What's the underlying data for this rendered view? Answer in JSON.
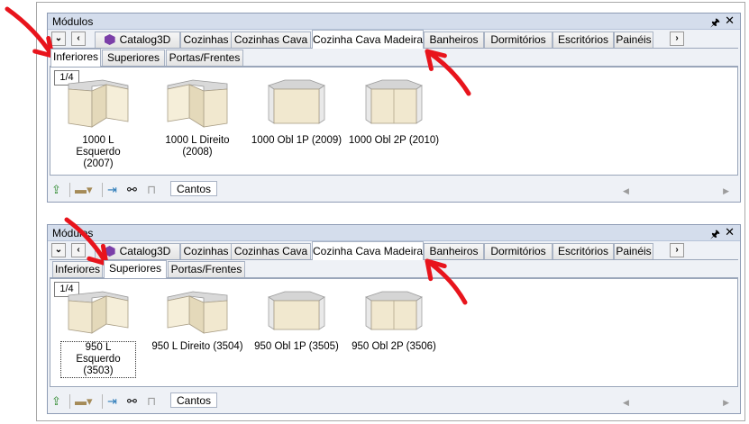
{
  "panels": [
    {
      "title": "Módulos",
      "pin_glyph": "🖈",
      "close_glyph": "✕",
      "nav_down": "⌄",
      "nav_left": "‹",
      "nav_right": "›",
      "tabs": [
        {
          "label": "Catalog3D",
          "icon": "cube-icon",
          "active": false
        },
        {
          "label": "Cozinhas",
          "active": false
        },
        {
          "label": "Cozinhas Cava",
          "active": false
        },
        {
          "label": "Cozinha Cava Madeira",
          "active": true
        },
        {
          "label": "Banheiros",
          "active": false
        },
        {
          "label": "Dormitórios",
          "active": false
        },
        {
          "label": "Escritórios",
          "active": false
        },
        {
          "label": "Painéis",
          "active": false
        }
      ],
      "subtabs": [
        {
          "label": "Inferiores",
          "active": true
        },
        {
          "label": "Superiores",
          "active": false
        },
        {
          "label": "Portas/Frentes",
          "active": false
        }
      ],
      "pager": "1/4",
      "items": [
        {
          "label": "1000 L Esquerdo (2007)",
          "shape": "l-left",
          "selected": false
        },
        {
          "label": "1000 L Direito (2008)",
          "shape": "l-right",
          "selected": false
        },
        {
          "label": "1000 Obl 1P (2009)",
          "shape": "obl",
          "selected": false
        },
        {
          "label": "1000 Obl 2P (2010)",
          "shape": "obl2",
          "selected": false
        }
      ],
      "bottom": {
        "tab_label": "Cantos"
      }
    },
    {
      "title": "Módulos",
      "pin_glyph": "🖈",
      "close_glyph": "✕",
      "nav_down": "⌄",
      "nav_left": "‹",
      "nav_right": "›",
      "tabs": [
        {
          "label": "Catalog3D",
          "icon": "cube-icon",
          "active": false
        },
        {
          "label": "Cozinhas",
          "active": false
        },
        {
          "label": "Cozinhas Cava",
          "active": false
        },
        {
          "label": "Cozinha Cava Madeira",
          "active": true
        },
        {
          "label": "Banheiros",
          "active": false
        },
        {
          "label": "Dormitórios",
          "active": false
        },
        {
          "label": "Escritórios",
          "active": false
        },
        {
          "label": "Painéis",
          "active": false
        }
      ],
      "subtabs": [
        {
          "label": "Inferiores",
          "active": false
        },
        {
          "label": "Superiores",
          "active": true
        },
        {
          "label": "Portas/Frentes",
          "active": false
        }
      ],
      "pager": "1/4",
      "items": [
        {
          "label": "950 L Esquerdo (3503)",
          "shape": "l-left",
          "selected": true
        },
        {
          "label": "950 L Direito (3504)",
          "shape": "l-right",
          "selected": false
        },
        {
          "label": "950 Obl 1P (3505)",
          "shape": "obl",
          "selected": false
        },
        {
          "label": "950 Obl 2P (3506)",
          "shape": "obl2",
          "selected": false
        }
      ],
      "bottom": {
        "tab_label": "Cantos"
      }
    }
  ],
  "colors": {
    "annotation_arrow": "#e8141c",
    "cabinet_body": "#efe6cc",
    "cabinet_top": "#d8d8d8",
    "accent_tab_border": "#a9b3c4"
  }
}
